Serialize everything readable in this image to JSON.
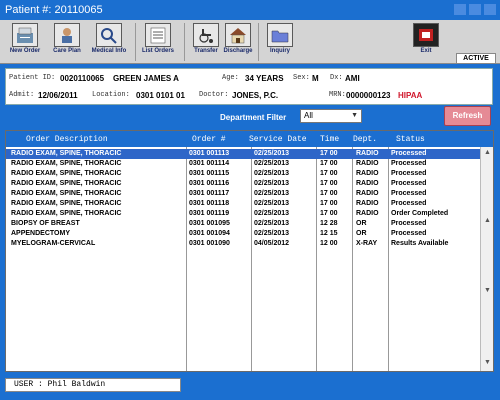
{
  "window": {
    "title": "Patient #:  20110065"
  },
  "toolbar": {
    "buttons": [
      {
        "label": "New Order",
        "icon": "new-order-icon"
      },
      {
        "label": "Care Plan",
        "icon": "care-plan-icon"
      },
      {
        "label": "Medical Info",
        "icon": "medical-info-icon"
      },
      {
        "label": "List Orders",
        "icon": "list-orders-icon"
      },
      {
        "label": "Transfer",
        "icon": "wheelchair-icon"
      },
      {
        "label": "Discharge",
        "icon": "house-icon"
      },
      {
        "label": "Inquiry",
        "icon": "folder-icon"
      },
      {
        "label": "Exit",
        "icon": "exit-icon"
      }
    ],
    "status": "ACTIVE"
  },
  "patient": {
    "id_label": "Patient ID:",
    "id": "0020110065",
    "name": "GREEN JAMES A",
    "age_label": "Age:",
    "age": "34 YEARS",
    "sex_label": "Sex:",
    "sex": "M",
    "dx_label": "Dx:",
    "dx": "AMI",
    "admit_label": "Admit:",
    "admit": "12/06/2011",
    "location_label": "Location:",
    "location": "0301 0101 01",
    "doctor_label": "Doctor:",
    "doctor": "JONES, P.C.",
    "mrn_label": "MRN:",
    "mrn": "0000000123",
    "hipaa": "HIPAA"
  },
  "filter": {
    "label": "Department Filter",
    "value": "All"
  },
  "refresh_label": "Refresh",
  "grid": {
    "headers": [
      "Order Description",
      "Order #",
      "Service Date",
      "Time",
      "Dept.",
      "Status"
    ],
    "rows": [
      [
        "RADIO EXAM, SPINE, THORACIC",
        "0301 001113",
        "02/25/2013",
        "17 00",
        "RADIO",
        "Processed"
      ],
      [
        "RADIO EXAM, SPINE, THORACIC",
        "0301 001114",
        "02/25/2013",
        "17 00",
        "RADIO",
        "Processed"
      ],
      [
        "RADIO EXAM, SPINE, THORACIC",
        "0301 001115",
        "02/25/2013",
        "17 00",
        "RADIO",
        "Processed"
      ],
      [
        "RADIO EXAM, SPINE, THORACIC",
        "0301 001116",
        "02/25/2013",
        "17 00",
        "RADIO",
        "Processed"
      ],
      [
        "RADIO EXAM, SPINE, THORACIC",
        "0301 001117",
        "02/25/2013",
        "17 00",
        "RADIO",
        "Processed"
      ],
      [
        "RADIO EXAM, SPINE, THORACIC",
        "0301 001118",
        "02/25/2013",
        "17 00",
        "RADIO",
        "Processed"
      ],
      [
        "RADIO EXAM, SPINE, THORACIC",
        "0301 001119",
        "02/25/2013",
        "17 00",
        "RADIO",
        "Order Completed"
      ],
      [
        "BIOPSY OF BREAST",
        "0301 001095",
        "02/25/2013",
        "12 28",
        "OR",
        "Processed"
      ],
      [
        "APPENDECTOMY",
        "0301 001094",
        "02/25/2013",
        "12 15",
        "OR",
        "Processed"
      ],
      [
        "MYELOGRAM-CERVICAL",
        "0301 001090",
        "04/05/2012",
        "12 00",
        "X-RAY",
        "Results Available"
      ]
    ]
  },
  "user": "USER : Phil Baldwin",
  "colors": {
    "window_blue": "#1b6fd0",
    "selected_row": "#2e66c8",
    "refresh": "#e58a95",
    "hipaa": "#d0162b"
  }
}
